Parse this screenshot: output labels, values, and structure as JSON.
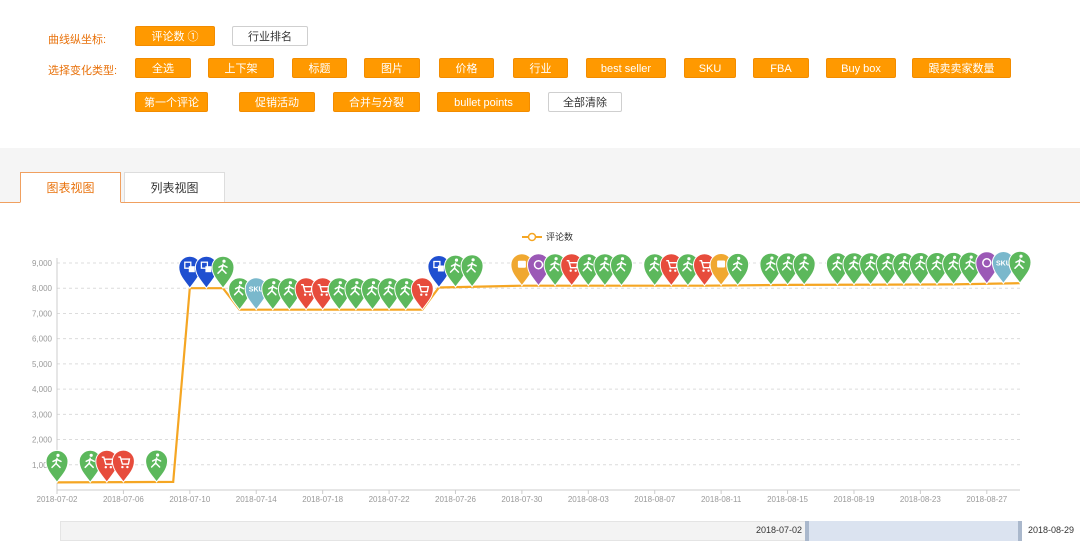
{
  "filters": {
    "y_label": "曲线纵坐标:",
    "y_buttons": [
      {
        "label": "评论数 ①",
        "active": true
      },
      {
        "label": "行业排名",
        "active": false
      }
    ],
    "type_label": "选择变化类型:",
    "type_buttons": [
      {
        "label": "全选",
        "active": true
      },
      {
        "label": "上下架",
        "active": true
      },
      {
        "label": "标题",
        "active": true
      },
      {
        "label": "图片",
        "active": true
      },
      {
        "label": "价格",
        "active": true
      },
      {
        "label": "行业",
        "active": true
      },
      {
        "label": "best seller",
        "active": true
      },
      {
        "label": "SKU",
        "active": true
      },
      {
        "label": "FBA",
        "active": true
      },
      {
        "label": "Buy box",
        "active": true
      },
      {
        "label": "跟卖卖家数量",
        "active": true
      },
      {
        "label": "第一个评论",
        "active": true
      },
      {
        "label": "促销活动",
        "active": true
      },
      {
        "label": "合并与分裂",
        "active": true
      },
      {
        "label": "bullet points",
        "active": true
      },
      {
        "label": "全部清除",
        "active": false
      }
    ]
  },
  "tabs": [
    {
      "label": "图表视图",
      "active": true
    },
    {
      "label": "列表视图",
      "active": false
    }
  ],
  "zoom": {
    "start": "2018-07-02",
    "end": "2018-08-29"
  },
  "colors": {
    "accent": "#ff9900",
    "line": "#f5a623",
    "green": "#5cb85c",
    "red": "#e74c3c",
    "blue": "#1f4fd0",
    "teal": "#7ab8cc",
    "purple": "#9b59b6"
  },
  "chart_data": {
    "type": "line",
    "legend": "评论数",
    "legend_position": "top-center",
    "grid": true,
    "ylim": [
      0,
      9000
    ],
    "y_ticks": [
      1000,
      2000,
      3000,
      4000,
      5000,
      6000,
      7000,
      8000,
      9000
    ],
    "y_tick_labels": [
      "1,000",
      "2,000",
      "3,000",
      "4,000",
      "5,000",
      "6,000",
      "7,000",
      "8,000",
      "9,000"
    ],
    "x_tick_labels": [
      "2018-07-02",
      "2018-07-06",
      "2018-07-10",
      "2018-07-14",
      "2018-07-18",
      "2018-07-22",
      "2018-07-26",
      "2018-07-30",
      "2018-08-03",
      "2018-08-07",
      "2018-08-11",
      "2018-08-15",
      "2018-08-19",
      "2018-08-23",
      "2018-08-27"
    ],
    "series": [
      {
        "name": "评论数",
        "points": [
          [
            "2018-07-02",
            300
          ],
          [
            "2018-07-09",
            320
          ],
          [
            "2018-07-10",
            8000
          ],
          [
            "2018-07-12",
            8000
          ],
          [
            "2018-07-13",
            7150
          ],
          [
            "2018-07-24",
            7150
          ],
          [
            "2018-07-25",
            8030
          ],
          [
            "2018-07-30",
            8100
          ],
          [
            "2018-08-10",
            8100
          ],
          [
            "2018-08-15",
            8130
          ],
          [
            "2018-08-25",
            8150
          ],
          [
            "2018-08-29",
            8200
          ]
        ]
      }
    ],
    "markers": [
      {
        "date": "2018-07-02",
        "kind": "green"
      },
      {
        "date": "2018-07-04",
        "kind": "green"
      },
      {
        "date": "2018-07-05",
        "kind": "red"
      },
      {
        "date": "2018-07-06",
        "kind": "red"
      },
      {
        "date": "2018-07-08",
        "kind": "green"
      },
      {
        "date": "2018-07-10",
        "kind": "blue"
      },
      {
        "date": "2018-07-11",
        "kind": "blue"
      },
      {
        "date": "2018-07-12",
        "kind": "green"
      },
      {
        "date": "2018-07-13",
        "kind": "green"
      },
      {
        "date": "2018-07-14",
        "kind": "sku"
      },
      {
        "date": "2018-07-15",
        "kind": "green"
      },
      {
        "date": "2018-07-16",
        "kind": "green"
      },
      {
        "date": "2018-07-17",
        "kind": "red"
      },
      {
        "date": "2018-07-18",
        "kind": "red"
      },
      {
        "date": "2018-07-19",
        "kind": "green"
      },
      {
        "date": "2018-07-20",
        "kind": "green"
      },
      {
        "date": "2018-07-21",
        "kind": "green"
      },
      {
        "date": "2018-07-22",
        "kind": "green"
      },
      {
        "date": "2018-07-23",
        "kind": "green"
      },
      {
        "date": "2018-07-24",
        "kind": "red"
      },
      {
        "date": "2018-07-25",
        "kind": "blue"
      },
      {
        "date": "2018-07-26",
        "kind": "green"
      },
      {
        "date": "2018-07-27",
        "kind": "green"
      },
      {
        "date": "2018-07-30",
        "kind": "orange"
      },
      {
        "date": "2018-07-31",
        "kind": "purple"
      },
      {
        "date": "2018-08-01",
        "kind": "green"
      },
      {
        "date": "2018-08-02",
        "kind": "red"
      },
      {
        "date": "2018-08-03",
        "kind": "green"
      },
      {
        "date": "2018-08-04",
        "kind": "green"
      },
      {
        "date": "2018-08-05",
        "kind": "green"
      },
      {
        "date": "2018-08-07",
        "kind": "green"
      },
      {
        "date": "2018-08-08",
        "kind": "red"
      },
      {
        "date": "2018-08-09",
        "kind": "green"
      },
      {
        "date": "2018-08-10",
        "kind": "red"
      },
      {
        "date": "2018-08-11",
        "kind": "orange"
      },
      {
        "date": "2018-08-12",
        "kind": "green"
      },
      {
        "date": "2018-08-14",
        "kind": "green"
      },
      {
        "date": "2018-08-15",
        "kind": "green"
      },
      {
        "date": "2018-08-16",
        "kind": "green"
      },
      {
        "date": "2018-08-18",
        "kind": "green"
      },
      {
        "date": "2018-08-19",
        "kind": "green"
      },
      {
        "date": "2018-08-20",
        "kind": "green"
      },
      {
        "date": "2018-08-21",
        "kind": "green"
      },
      {
        "date": "2018-08-22",
        "kind": "green"
      },
      {
        "date": "2018-08-23",
        "kind": "green"
      },
      {
        "date": "2018-08-24",
        "kind": "green"
      },
      {
        "date": "2018-08-25",
        "kind": "green"
      },
      {
        "date": "2018-08-26",
        "kind": "green"
      },
      {
        "date": "2018-08-27",
        "kind": "purple"
      },
      {
        "date": "2018-08-28",
        "kind": "sku"
      },
      {
        "date": "2018-08-29",
        "kind": "green"
      }
    ]
  }
}
